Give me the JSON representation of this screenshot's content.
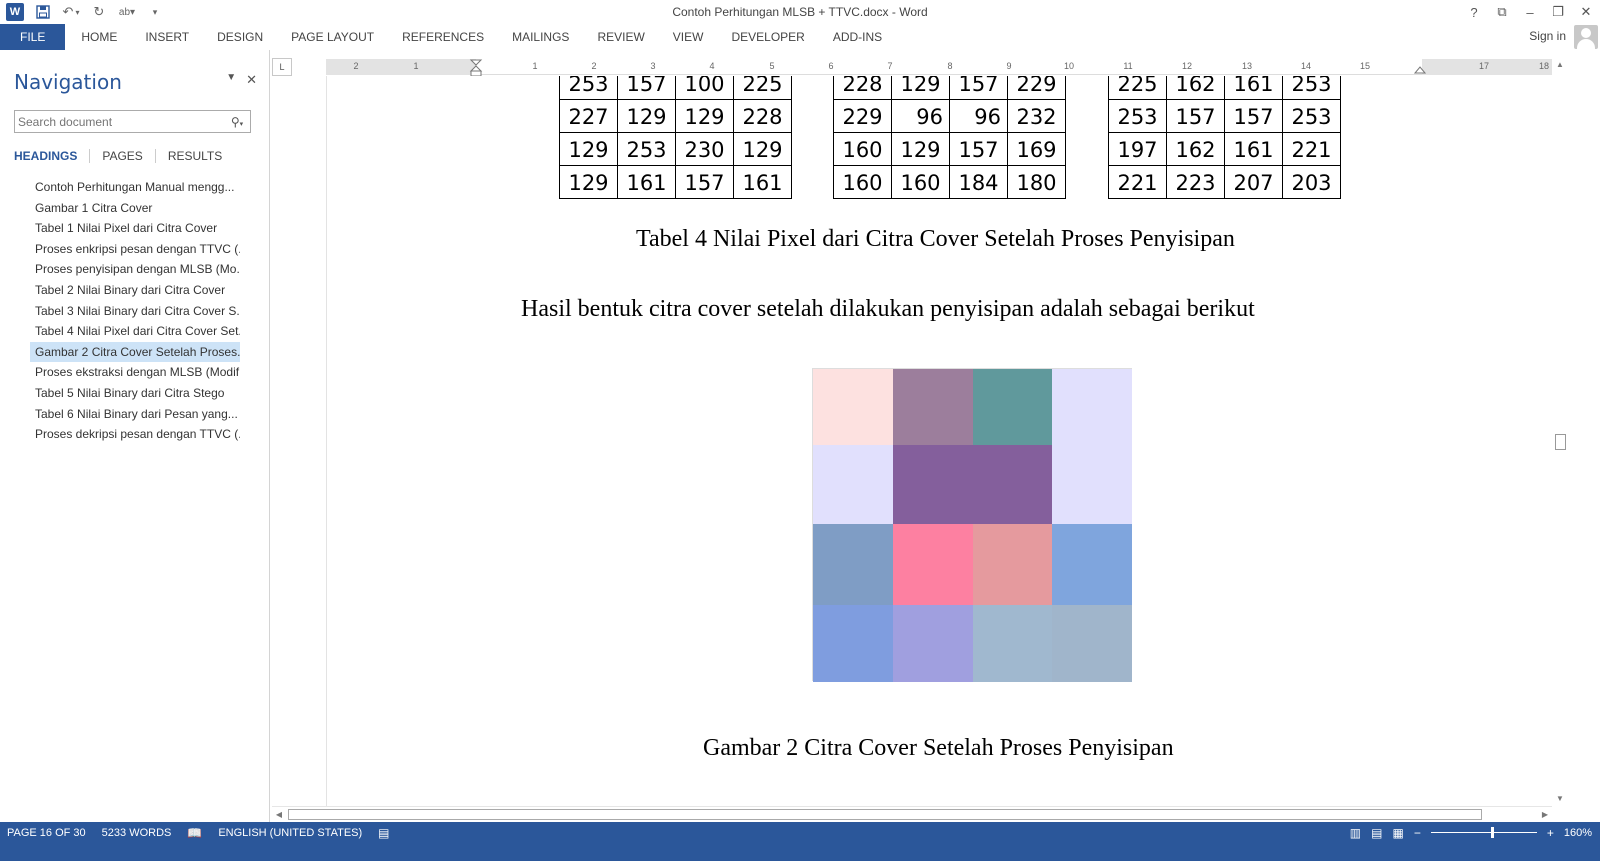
{
  "app": {
    "title": "Contoh Perhitungan MLSB + TTVC.docx - Word",
    "sign_in": "Sign in"
  },
  "ribbon": {
    "tabs": [
      "FILE",
      "HOME",
      "INSERT",
      "DESIGN",
      "PAGE LAYOUT",
      "REFERENCES",
      "MAILINGS",
      "REVIEW",
      "VIEW",
      "DEVELOPER",
      "ADD-INS"
    ]
  },
  "navigation": {
    "title": "Navigation",
    "search_placeholder": "Search document",
    "tabs": [
      "HEADINGS",
      "PAGES",
      "RESULTS"
    ],
    "headings": [
      "Contoh Perhitungan Manual mengg...",
      "Gambar 1 Citra Cover",
      "Tabel 1 Nilai Pixel dari Citra Cover",
      "Proses enkripsi pesan dengan TTVC (...",
      "Proses penyisipan dengan MLSB (Mo...",
      "Tabel 2 Nilai Binary dari Citra Cover",
      "Tabel 3 Nilai Binary dari Citra Cover S...",
      "Tabel 4 Nilai Pixel dari Citra Cover Set...",
      "Gambar 2 Citra Cover Setelah Proses...",
      "Proses ekstraksi dengan MLSB (Modif...",
      "Tabel 5 Nilai Binary dari Citra Stego",
      "Tabel 6 Nilai Binary dari Pesan yang...",
      "Proses dekripsi pesan dengan TTVC (..."
    ],
    "selected_index": 8
  },
  "ruler": {
    "numbers": [
      "2",
      "1",
      "1",
      "2",
      "3",
      "4",
      "5",
      "6",
      "7",
      "8",
      "9",
      "10",
      "11",
      "12",
      "13",
      "14",
      "15",
      "17",
      "18"
    ]
  },
  "document": {
    "table_1": [
      [
        "253",
        "157",
        "100",
        "225"
      ],
      [
        "227",
        "129",
        "129",
        "228"
      ],
      [
        "129",
        "253",
        "230",
        "129"
      ],
      [
        "129",
        "161",
        "157",
        "161"
      ]
    ],
    "table_2": [
      [
        "228",
        "129",
        "157",
        "229"
      ],
      [
        "229",
        "96",
        "96",
        "232"
      ],
      [
        "160",
        "129",
        "157",
        "169"
      ],
      [
        "160",
        "160",
        "184",
        "180"
      ]
    ],
    "table_3": [
      [
        "225",
        "162",
        "161",
        "253"
      ],
      [
        "253",
        "157",
        "157",
        "253"
      ],
      [
        "197",
        "162",
        "161",
        "221"
      ],
      [
        "221",
        "223",
        "207",
        "203"
      ]
    ],
    "table_caption": "Tabel 4 Nilai Pixel dari Citra Cover Setelah Proses Penyisipan",
    "paragraph": "Hasil bentuk citra cover setelah dilakukan penyisipan adalah sebagai berikut",
    "image_pixels": [
      [
        "#fde1e0",
        "#9c7e9c",
        "#60999c",
        "#e1e0fd"
      ],
      [
        "#e1e0fd",
        "#845f9c",
        "#845f9c",
        "#e1e0fd"
      ],
      [
        "#7f9dc5",
        "#fd80a1",
        "#e59a9e",
        "#7fa5dd"
      ],
      [
        "#7f9ddf",
        "#a09fdf",
        "#a0b8cf",
        "#a0b5cb"
      ]
    ],
    "figure_caption": "Gambar 2 Citra Cover Setelah Proses Penyisipan"
  },
  "status": {
    "page": "PAGE 16 OF 30",
    "words": "5233 WORDS",
    "language": "ENGLISH (UNITED STATES)",
    "zoom": "160%"
  },
  "colors": {
    "accent": "#2b579a",
    "selected_heading": "#cde3f7"
  }
}
